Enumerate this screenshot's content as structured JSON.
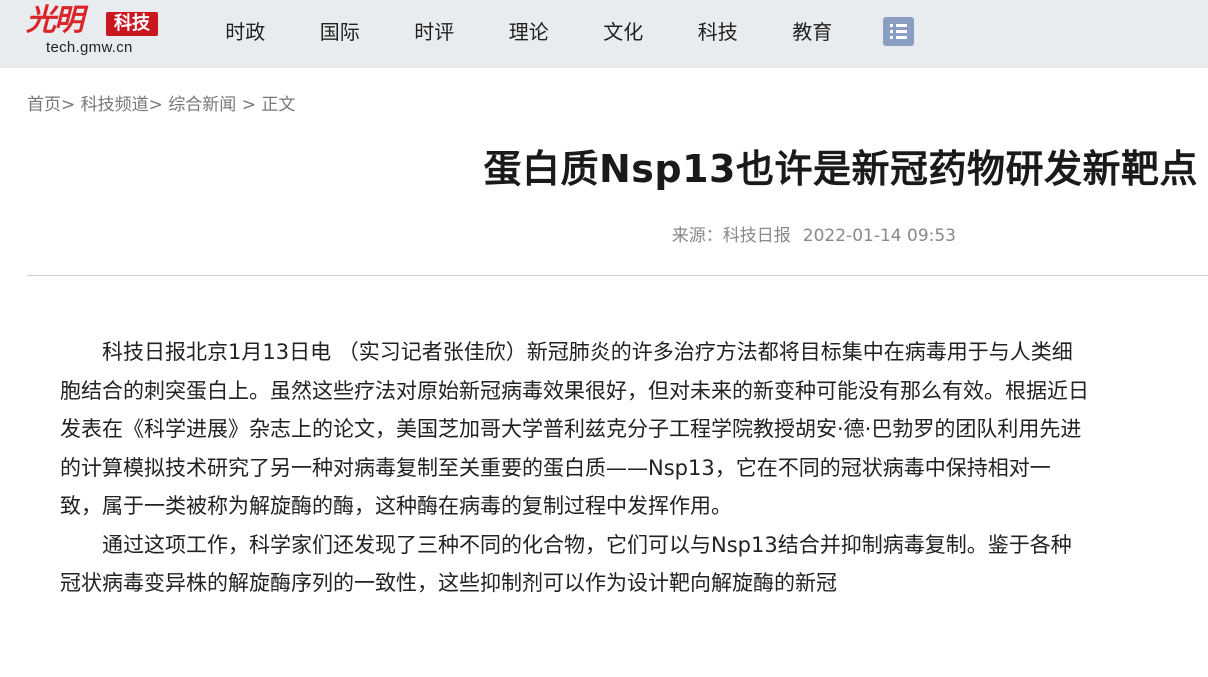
{
  "header": {
    "logo_script": "光明",
    "logo_badge": "科技",
    "logo_url": "tech.gmw.cn",
    "nav": [
      "时政",
      "国际",
      "时评",
      "理论",
      "文化",
      "科技",
      "教育"
    ],
    "menu_icon": "list-menu-icon"
  },
  "breadcrumb": {
    "home": "首页",
    "sep1": ">",
    "channel": "科技频道",
    "sep2": ">",
    "section": "综合新闻",
    "sep3": " > ",
    "current": "正文"
  },
  "article": {
    "title": "蛋白质Nsp13也许是新冠药物研发新靶点",
    "source_label": "来源：科技日报",
    "date": "2022-01-14 09:53",
    "paragraphs": [
      "科技日报北京1月13日电 （实习记者张佳欣）新冠肺炎的许多治疗方法都将目标集中在病毒用于与人类细胞结合的刺突蛋白上。虽然这些疗法对原始新冠病毒效果很好，但对未来的新变种可能没有那么有效。根据近日发表在《科学进展》杂志上的论文，美国芝加哥大学普利兹克分子工程学院教授胡安·德·巴勃罗的团队利用先进的计算模拟技术研究了另一种对病毒复制至关重要的蛋白质——Nsp13，它在不同的冠状病毒中保持相对一致，属于一类被称为解旋酶的酶，这种酶在病毒的复制过程中发挥作用。",
      "通过这项工作，科学家们还发现了三种不同的化合物，它们可以与Nsp13结合并抑制病毒复制。鉴于各种冠状病毒变异株的解旋酶序列的一致性，这些抑制剂可以作为设计靶向解旋酶的新冠"
    ]
  },
  "colors": {
    "topbar_bg": "#e9ecef",
    "brand_red": "#c8171e",
    "menu_button": "#8a9ec4"
  }
}
